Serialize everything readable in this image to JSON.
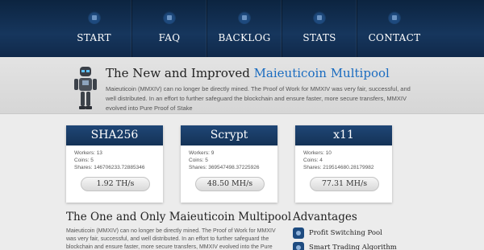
{
  "nav": {
    "items": [
      {
        "label": "START",
        "icon": "home-icon"
      },
      {
        "label": "FAQ",
        "icon": "question-icon"
      },
      {
        "label": "BACKLOG",
        "icon": "list-icon"
      },
      {
        "label": "STATS",
        "icon": "chart-icon"
      },
      {
        "label": "CONTACT",
        "icon": "mail-icon"
      }
    ]
  },
  "hero": {
    "title_prefix": "The New and Improved ",
    "title_accent": "Maieuticoin Multipool",
    "description": "Maieuticoin (MMXIV) can no longer be directly mined. The Proof of Work for MMXIV was very fair, successful, and well distributed. In an effort to further safeguard the blockchain and ensure faster, more secure transfers, MMXIV evolved into Pure Proof of Stake"
  },
  "pools": [
    {
      "name": "SHA256",
      "workers": "Workers: 13",
      "coins": "Coins: 5",
      "shares": "Shares: 146706233.72885346",
      "rate": "1.92 TH/s"
    },
    {
      "name": "Scrypt",
      "workers": "Workers: 9",
      "coins": "Coins: 5",
      "shares": "Shares: 369547498.37225926",
      "rate": "48.50 MH/s"
    },
    {
      "name": "x11",
      "workers": "Workers: 10",
      "coins": "Coins: 4",
      "shares": "Shares: 219514680.28179982",
      "rate": "77.31 MH/s"
    }
  ],
  "about": {
    "title": "The One and Only Maieuticoin Multipool",
    "description": "Maieuticoin (MMXIV) can no longer be directly mined. The Proof of Work for MMXIV was very fair, successful, and well distributed. In an effort to further safeguard the blockchain and ensure faster, more secure transfers, MMXIV evolved into the Pure Proof of Stake"
  },
  "advantages": {
    "title": "Advantages",
    "items": [
      {
        "label": "Profit Switching Pool",
        "icon": "coins-icon"
      },
      {
        "label": "Smart Trading Algorithm",
        "icon": "algorithm-icon"
      }
    ]
  },
  "colors": {
    "nav_bg": "#16365d",
    "accent": "#1a6cc0",
    "card_header": "#1f4676"
  }
}
